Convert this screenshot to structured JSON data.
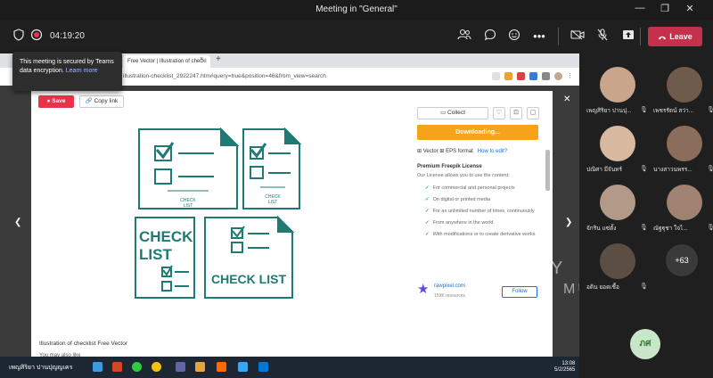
{
  "window": {
    "title": "Meeting in \"General\"",
    "minimize": "—",
    "maximize": "❐",
    "close": "✕"
  },
  "toolbar": {
    "timer": "04:19:20",
    "leave_label": "Leave",
    "more_label": "•••"
  },
  "tooltip": {
    "text": "This meeting is secured by Teams data encryption.",
    "link": "Learn more"
  },
  "browser": {
    "tab_title": "Free Vector | Illustration of checkl",
    "tab_close": "×",
    "new_tab": "+",
    "address": "illustration-checklist_2922247.htm#query=true&position=46&from_view=search"
  },
  "modal": {
    "save_label": "Save",
    "copy_link_label": "Copy link",
    "collect_label": "Collect",
    "download_label": "Downloading...",
    "vector_format": "Vector",
    "eps_format": "EPS format",
    "how_to_edit": "How to edit?",
    "license_title": "Premium Freepik License",
    "license_sub": "Our License allows you to use the content:",
    "license_items": [
      "For commercial and personal projects",
      "On digital or printed media",
      "For an unlimited number of times, continuously",
      "From anywhere in the world",
      "With modifications or to create derivative works"
    ],
    "author": "rawpixel.com",
    "author_sub": "159K resources",
    "follow_label": "Follow",
    "illustration_title": "Illustration of checklist Free Vector",
    "you_may_also_like": "You may also like",
    "close": "✕",
    "prev": "❮",
    "next": "❯",
    "art_check": "CHECK",
    "art_list": "LIST",
    "art_checklist": "CHECK LIST",
    "art_checklist_small_1": "CHECK",
    "art_checklist_small_2": "LIST"
  },
  "taskbar": {
    "presenter_name": "เพญสิริยา ปานปุญญเคร",
    "time": "13:08",
    "date": "5/2/2565"
  },
  "participants": [
    {
      "name": "เพญสิริยา ปานปุ...",
      "color": "#c9a58c"
    },
    {
      "name": "เพชรรัตน์ สว่า...",
      "color": "#6f5b4c"
    },
    {
      "name": "ปณิศา มีจันทร์",
      "color": "#d9b8a0"
    },
    {
      "name": "นางสาวนพรร...",
      "color": "#8a6d5a"
    },
    {
      "name": "จักริน แซ่ตั้ง",
      "color": "#b39a88"
    },
    {
      "name": "ณัฐฐุชา ใจไ...",
      "color": "#a08270"
    },
    {
      "name": "อดิน ยอดเชื้อ",
      "color": "#5d4e44"
    }
  ],
  "overflow_count": "+63",
  "my_initials": "ภศ",
  "watermark": {
    "line1": "Y",
    "line2": "MUTT"
  },
  "colors": {
    "leave": "#c4314b",
    "download": "#f7a21b",
    "save": "#e8334a",
    "checklist": "#1f7a73"
  }
}
